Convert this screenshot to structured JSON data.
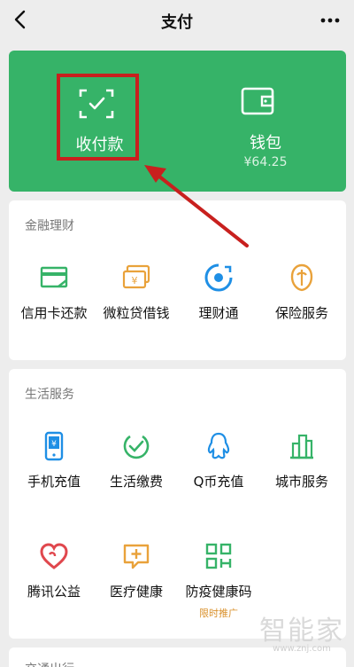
{
  "nav": {
    "title": "支付"
  },
  "wallet_card": {
    "pay_label": "收付款",
    "wallet_label": "钱包",
    "balance": "¥64.25"
  },
  "finance": {
    "title": "金融理财",
    "items": [
      {
        "label": "信用卡还款",
        "icon": "credit-card-icon"
      },
      {
        "label": "微粒贷借钱",
        "icon": "loan-card-icon"
      },
      {
        "label": "理财通",
        "icon": "wealth-icon"
      },
      {
        "label": "保险服务",
        "icon": "insurance-icon"
      }
    ]
  },
  "life": {
    "title": "生活服务",
    "items": [
      {
        "label": "手机充值",
        "icon": "phone-topup-icon"
      },
      {
        "label": "生活缴费",
        "icon": "utility-bill-icon"
      },
      {
        "label": "Q币充值",
        "icon": "qcoin-icon"
      },
      {
        "label": "城市服务",
        "icon": "city-service-icon"
      },
      {
        "label": "腾讯公益",
        "icon": "charity-heart-icon"
      },
      {
        "label": "医疗健康",
        "icon": "medical-icon"
      },
      {
        "label": "防疫健康码",
        "icon": "health-code-icon",
        "sub": "限时推广"
      }
    ]
  },
  "next_section": {
    "title": "交通出行"
  },
  "watermark": {
    "text": "智能家",
    "url": "www.znj.com"
  },
  "colors": {
    "brand_green": "#36b368",
    "highlight_red": "#c8201e"
  }
}
